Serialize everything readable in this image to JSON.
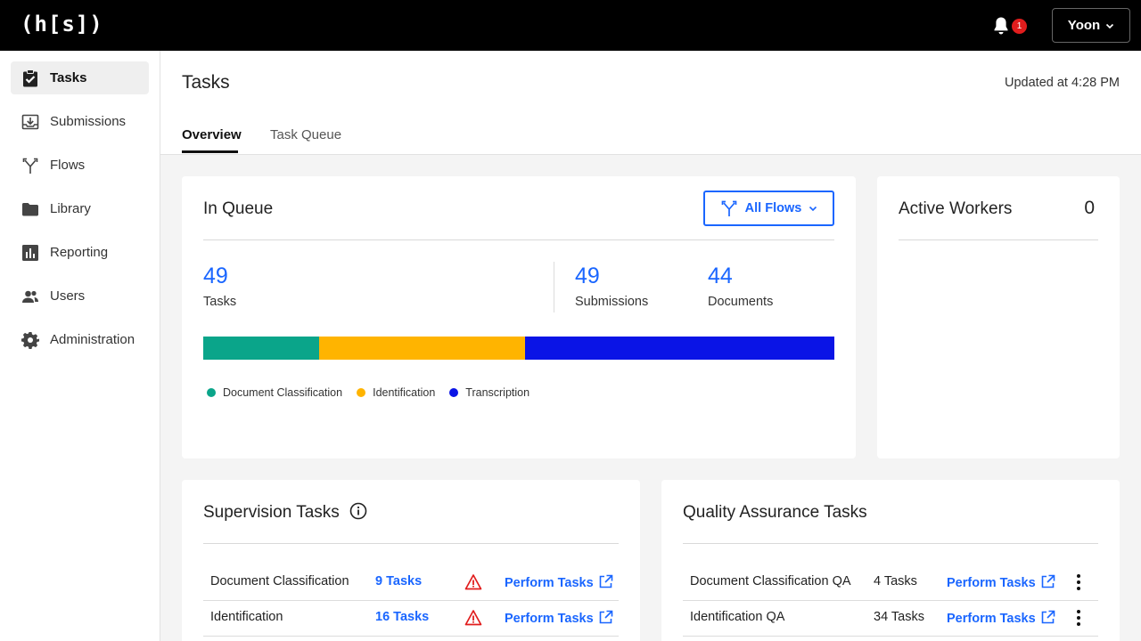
{
  "app": {
    "logo": "(h[s])"
  },
  "topbar": {
    "notification_count": "1",
    "user_name": "Yoon"
  },
  "sidebar": {
    "items": [
      {
        "label": "Tasks",
        "icon": "clipboard-check-icon",
        "active": true
      },
      {
        "label": "Submissions",
        "icon": "tray-download-icon"
      },
      {
        "label": "Flows",
        "icon": "flow-branch-icon"
      },
      {
        "label": "Library",
        "icon": "folder-icon"
      },
      {
        "label": "Reporting",
        "icon": "bar-chart-icon"
      },
      {
        "label": "Users",
        "icon": "users-icon"
      },
      {
        "label": "Administration",
        "icon": "gear-icon"
      }
    ]
  },
  "header": {
    "title": "Tasks",
    "updated": "Updated at 4:28 PM",
    "tabs": [
      {
        "label": "Overview",
        "active": true
      },
      {
        "label": "Task Queue"
      }
    ]
  },
  "queue": {
    "title": "In Queue",
    "filter_label": "All Flows",
    "stats": [
      {
        "value": "49",
        "label": "Tasks"
      },
      {
        "value": "49",
        "label": "Submissions"
      },
      {
        "value": "44",
        "label": "Documents"
      }
    ],
    "breakdown": [
      {
        "label": "Document Classification",
        "tasks": 9,
        "color": "#0aa58a"
      },
      {
        "label": "Identification",
        "tasks": 16,
        "color": "#ffb400"
      },
      {
        "label": "Transcription",
        "tasks": 24,
        "color": "#0a14e6"
      }
    ]
  },
  "workers": {
    "title": "Active Workers",
    "count": "0"
  },
  "supervision": {
    "title": "Supervision Tasks",
    "rows": [
      {
        "name": "Document Classification",
        "tasks": "9 Tasks",
        "action": "Perform Tasks"
      },
      {
        "name": "Identification",
        "tasks": "16 Tasks",
        "action": "Perform Tasks"
      }
    ]
  },
  "qa": {
    "title": "Quality Assurance Tasks",
    "rows": [
      {
        "name": "Document Classification QA",
        "tasks": "4 Tasks",
        "action": "Perform Tasks"
      },
      {
        "name": "Identification QA",
        "tasks": "34 Tasks",
        "action": "Perform Tasks"
      }
    ]
  },
  "colors": {
    "accent": "#1a66ff",
    "warning": "#e11d1d"
  }
}
